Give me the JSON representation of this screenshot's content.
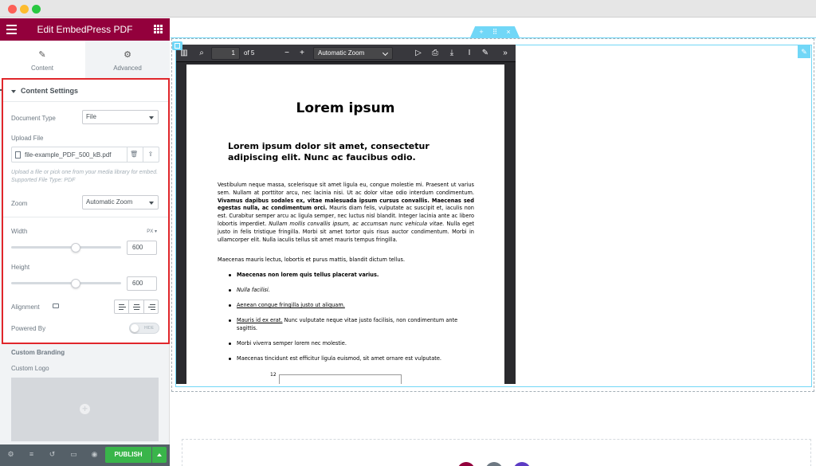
{
  "sidebar": {
    "header_title": "Edit EmbedPress PDF",
    "tabs": [
      {
        "label": "Content",
        "icon": "pencil-icon"
      },
      {
        "label": "Advanced",
        "icon": "gear-icon"
      }
    ],
    "section_title": "Content Settings",
    "document_type": {
      "label": "Document Type",
      "value": "File"
    },
    "upload_file": {
      "label": "Upload File",
      "filename": "file-example_PDF_500_kB.pdf"
    },
    "help_text": "Upload a file or pick one from your media library for embed. Supported File Type: PDF",
    "zoom": {
      "label": "Zoom",
      "value": "Automatic Zoom"
    },
    "width": {
      "label": "Width",
      "value": "600",
      "unit": "PX"
    },
    "height": {
      "label": "Height",
      "value": "600"
    },
    "alignment": {
      "label": "Alignment"
    },
    "powered_by": {
      "label": "Powered By",
      "toggle_text": "HIDE"
    },
    "custom_branding": {
      "title": "Custom Branding",
      "logo_label": "Custom Logo"
    },
    "footer": {
      "publish_label": "PUBLISH"
    },
    "accent_color": "#93003c",
    "highlight_color": "#e0262b"
  },
  "pdf": {
    "page_current": "1",
    "page_total_label": "of 5",
    "zoom_value": "Automatic Zoom",
    "title": "Lorem ipsum",
    "subtitle": "Lorem ipsum dolor sit amet, consectetur adipiscing elit. Nunc ac faucibus odio.",
    "para1_a": "Vestibulum neque massa, scelerisque sit amet ligula eu, congue molestie mi. Praesent ut varius sem. Nullam at porttitor arcu, nec lacinia nisi. Ut ac dolor vitae odio interdum condimentum. ",
    "para1_b": "Vivamus dapibus sodales ex, vitae malesuada ipsum cursus convallis. Maecenas sed egestas nulla, ac condimentum orci.",
    "para1_c": " Mauris diam felis, vulputate ac suscipit et, iaculis non est. Curabitur semper arcu ac ligula semper, nec luctus nisl blandit. Integer lacinia ante ac libero lobortis imperdiet. ",
    "para1_d": "Nullam mollis convallis ipsum, ac accumsan nunc vehicula vitae.",
    "para1_e": " Nulla eget justo in felis tristique fringilla. Morbi sit amet tortor quis risus auctor condimentum. Morbi in ullamcorper elit. Nulla iaculis tellus sit amet mauris tempus fringilla.",
    "para2": "Maecenas mauris lectus, lobortis et purus mattis, blandit dictum tellus.",
    "list": [
      "Maecenas non lorem quis tellus placerat varius.",
      "Nulla facilisi.",
      "Aenean congue fringilla justo ut aliquam.",
      "Mauris id ex erat.",
      " Nunc vulputate neque vitae justo facilisis, non condimentum ante sagittis.",
      "Morbi viverra semper lorem nec molestie.",
      "Maecenas tincidunt est efficitur ligula euismod, sit amet ornare est vulputate."
    ],
    "page_number": "12"
  }
}
